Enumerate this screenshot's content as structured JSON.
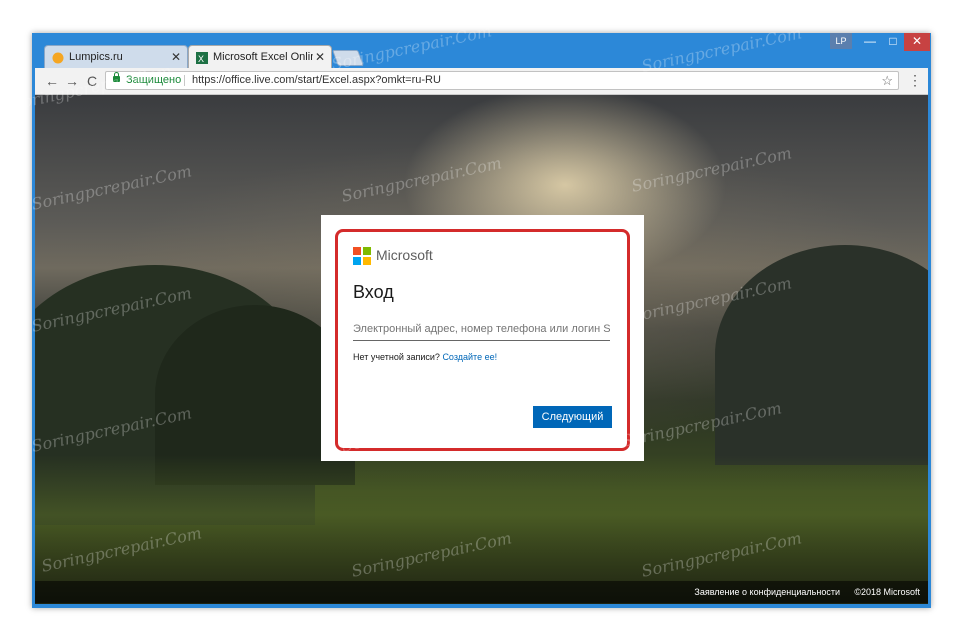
{
  "browser": {
    "tabs": [
      {
        "label": "Lumpics.ru",
        "close": "✕",
        "favicon": "lumpics-orange-icon"
      },
      {
        "label": "Microsoft Excel Online –",
        "close": "✕",
        "favicon": "excel-green-icon"
      }
    ],
    "user_badge": "LP",
    "window_controls": {
      "minimize": "—",
      "maximize": "□",
      "close": "✕"
    },
    "nav": {
      "back": "←",
      "forward": "→",
      "reload": "C"
    },
    "address": {
      "secure_label": "Защищено",
      "url": "https://office.live.com/start/Excel.aspx?omkt=ru-RU",
      "bookmark": "☆"
    },
    "menu": "⋮"
  },
  "login": {
    "brand": "Microsoft",
    "title": "Вход",
    "input_placeholder": "Электронный адрес, номер телефона или логин Skype",
    "no_account_text": "Нет учетной записи?",
    "create_link": "Создайте ее!",
    "next_button": "Следующий"
  },
  "footer": {
    "privacy": "Заявление о конфиденциальности",
    "copyright": "©2018 Microsoft"
  },
  "watermark": "Soringpcrepair.Com",
  "colors": {
    "window_frame": "#2c88d8",
    "highlight": "#d42b2b",
    "accent": "#0067b8",
    "secure": "#1b8a3a",
    "ms_red": "#f25022",
    "ms_green": "#7fba00",
    "ms_blue": "#00a4ef",
    "ms_yellow": "#ffb900"
  }
}
